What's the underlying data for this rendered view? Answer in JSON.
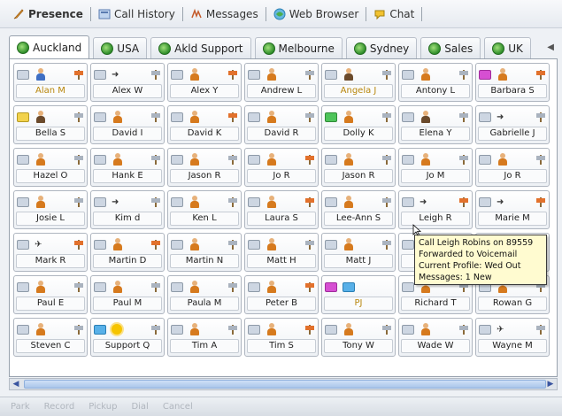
{
  "topbar": {
    "items": [
      {
        "label": "Presence",
        "icon": "pen-icon"
      },
      {
        "label": "Call History",
        "icon": "call-history-icon"
      },
      {
        "label": "Messages",
        "icon": "messages-icon"
      },
      {
        "label": "Web Browser",
        "icon": "web-browser-icon"
      },
      {
        "label": "Chat",
        "icon": "chat-icon"
      }
    ]
  },
  "tabs": [
    "Auckland",
    "USA",
    "Akld Support",
    "Melbourne",
    "Sydney",
    "Sales",
    "UK"
  ],
  "contacts": [
    "Alan M",
    "Alex W",
    "Alex Y",
    "Andrew L",
    "Angela J",
    "Antony L",
    "Barbara S",
    "Bella S",
    "David I",
    "David K",
    "David R",
    "Dolly K",
    "Elena Y",
    "Gabrielle J",
    "Hazel O",
    "Hank E",
    "Jason R",
    "Jo R",
    "Jason R",
    "Jo M",
    "Jo R",
    "Josie L",
    "Kim d",
    "Ken L",
    "Laura S",
    "Lee-Ann S",
    "Leigh R",
    "Marie M",
    "Mark R",
    "Martin D",
    "Martin N",
    "Matt H",
    "Matt J",
    "",
    "",
    "Paul E",
    "Paul M",
    "Paula M",
    "Peter B",
    "PJ",
    "Richard T",
    "Rowan G",
    "Steven C",
    "Support Q",
    "Tim A",
    "Tim S",
    "Tony W",
    "Wade W",
    "Wayne M"
  ],
  "tooltip": {
    "line1": "Call Leigh Robins on 89559",
    "line2": "Forwarded to Voicemail",
    "line3": "Current Profile: Wed Out",
    "line4": "Messages: 1 New"
  },
  "statusbar": [
    "Park",
    "Record",
    "Pickup",
    "Dial",
    "Cancel"
  ],
  "colors": {
    "accent": "#3f6fc4",
    "away": "#b8860b",
    "tooltip_bg": "#fffbd0"
  }
}
